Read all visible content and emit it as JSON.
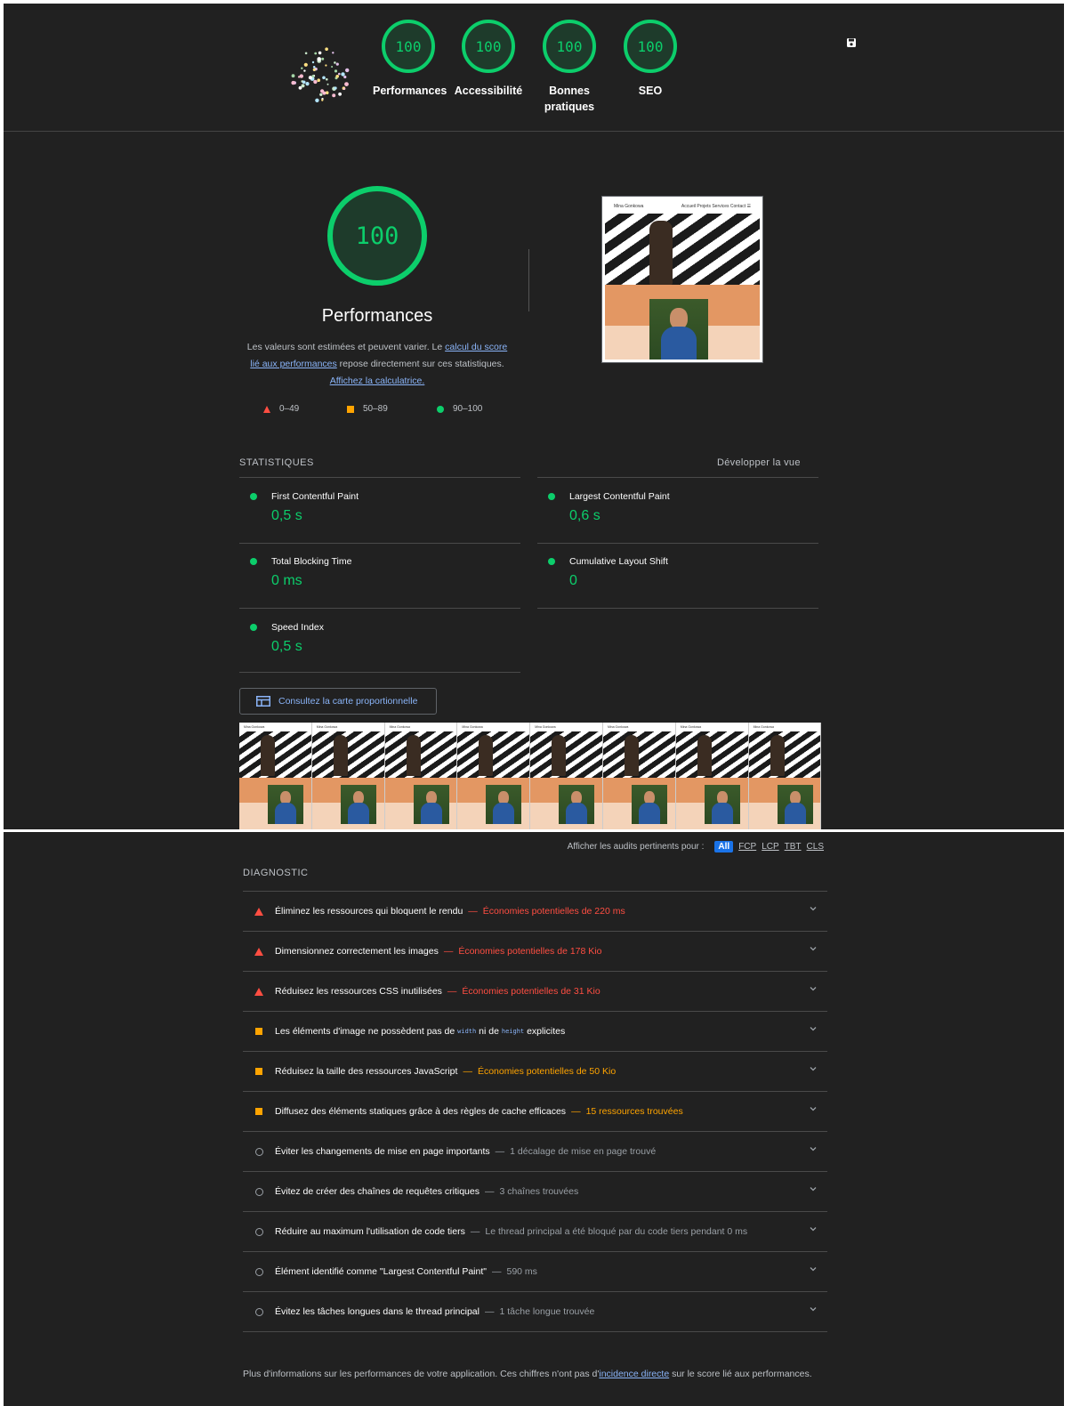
{
  "header": {
    "gauges": [
      {
        "score": "100",
        "label": "Performances"
      },
      {
        "score": "100",
        "label": "Accessibilité"
      },
      {
        "score": "100",
        "label": "Bonnes pratiques"
      },
      {
        "score": "100",
        "label": "SEO"
      }
    ],
    "colors": {
      "pass": "#0cce6b",
      "average": "#ffa400",
      "fail": "#ff4e42",
      "background": "#212121",
      "link": "#8ab4f8"
    }
  },
  "performance": {
    "score": "100",
    "title": "Performances",
    "desc_1": "Les valeurs sont estimées et peuvent varier. Le ",
    "desc_link_1": "calcul du score lié aux performances",
    "desc_2": " repose directement sur ces statistiques. ",
    "desc_link_2": "Affichez la calculatrice.",
    "legend": {
      "fail": "0–49",
      "average": "50–89",
      "pass": "90–100"
    }
  },
  "screenshot": {
    "site_title": "Mina Gonkowa",
    "nav_items": "Accueil  Projets  Services  Contact  ☰"
  },
  "statistics": {
    "heading": "STATISTIQUES",
    "expand": "Développer la vue",
    "metrics": [
      {
        "name": "First Contentful Paint",
        "value": "0,5 s"
      },
      {
        "name": "Largest Contentful Paint",
        "value": "0,6 s"
      },
      {
        "name": "Total Blocking Time",
        "value": "0 ms"
      },
      {
        "name": "Cumulative Layout Shift",
        "value": "0"
      },
      {
        "name": "Speed Index",
        "value": "0,5 s"
      }
    ],
    "treemap_button": "Consultez la carte proportionnelle"
  },
  "filter": {
    "label": "Afficher les audits pertinents pour :",
    "options": [
      "All",
      "FCP",
      "LCP",
      "TBT",
      "CLS"
    ]
  },
  "diagnostic": {
    "heading": "DIAGNOSTIC",
    "audits": [
      {
        "title": "Éliminez les ressources qui bloquent le rendu",
        "detail": "Économies potentielles de 220 ms"
      },
      {
        "title": "Dimensionnez correctement les images",
        "detail": "Économies potentielles de 178 Kio"
      },
      {
        "title": "Réduisez les ressources CSS inutilisées",
        "detail": "Économies potentielles de 31 Kio"
      },
      {
        "title_1": "Les éléments d'image ne possèdent pas de",
        "code_1": "width",
        "title_2": "ni de",
        "code_2": "height",
        "title_3": "explicites"
      },
      {
        "title": "Réduisez la taille des ressources JavaScript",
        "detail": "Économies potentielles de 50 Kio"
      },
      {
        "title": "Diffusez des éléments statiques grâce à des règles de cache efficaces",
        "detail": "15 ressources trouvées"
      },
      {
        "title": "Éviter les changements de mise en page importants",
        "detail": "1 décalage de mise en page trouvé"
      },
      {
        "title": "Évitez de créer des chaînes de requêtes critiques",
        "detail": "3 chaînes trouvées"
      },
      {
        "title": "Réduire au maximum l'utilisation de code tiers",
        "detail": "Le thread principal a été bloqué par du code tiers pendant 0 ms"
      },
      {
        "title": "Élément identifié comme \"Largest Contentful Paint\"",
        "detail": "590 ms"
      },
      {
        "title": "Évitez les tâches longues dans le thread principal",
        "detail": "1 tâche longue trouvée"
      }
    ],
    "dash": "—",
    "footnote_1": "Plus d'informations sur les performances de votre application. Ces chiffres n'ont pas d'",
    "footnote_link": "incidence directe",
    "footnote_2": " sur le score lié aux performances."
  }
}
